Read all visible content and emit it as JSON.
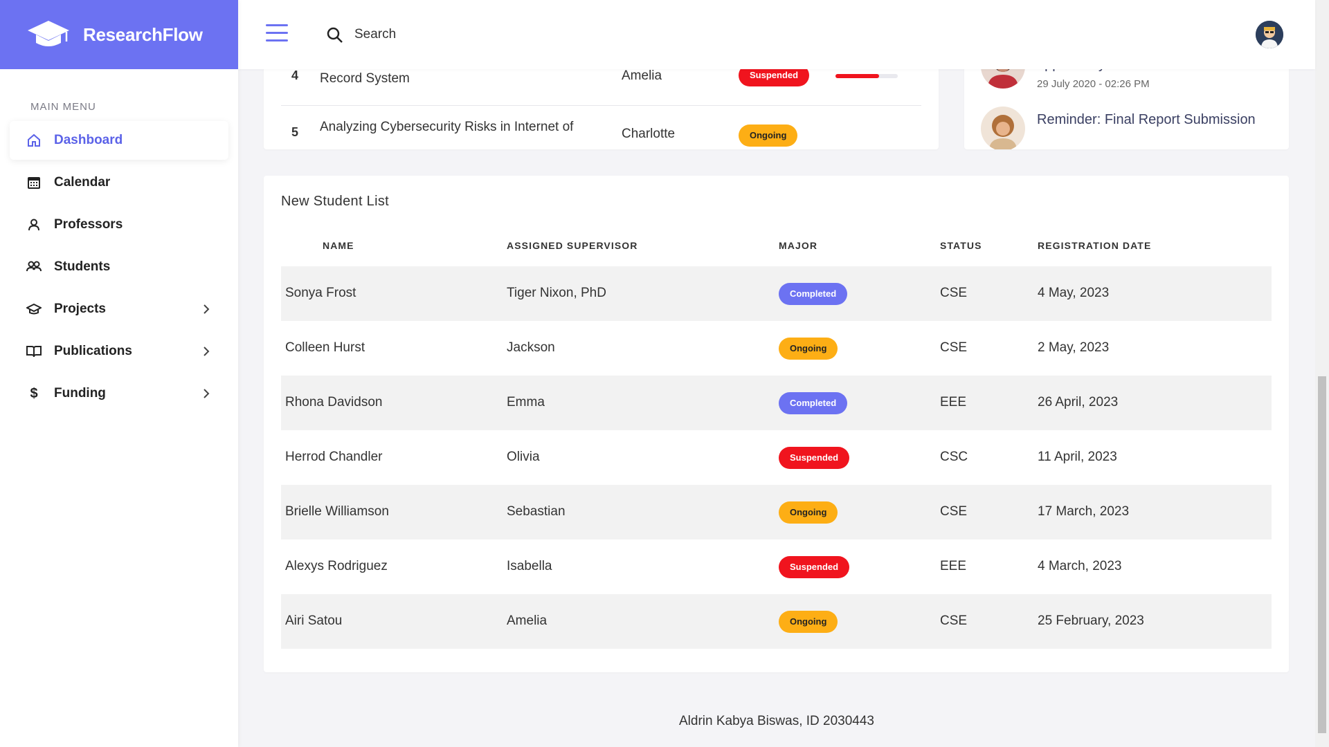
{
  "brand": {
    "name": "ResearchFlow"
  },
  "sidebar": {
    "heading": "MAIN MENU",
    "items": [
      {
        "label": "Dashboard",
        "icon": "home-icon",
        "active": true
      },
      {
        "label": "Calendar",
        "icon": "calendar-icon"
      },
      {
        "label": "Professors",
        "icon": "user-icon"
      },
      {
        "label": "Students",
        "icon": "users-icon"
      },
      {
        "label": "Projects",
        "icon": "graduation-cap-icon",
        "chevron": true
      },
      {
        "label": "Publications",
        "icon": "book-open-icon",
        "chevron": true
      },
      {
        "label": "Funding",
        "icon": "dollar-icon",
        "chevron": true
      }
    ]
  },
  "topbar": {
    "search_placeholder": "Search"
  },
  "projects": {
    "rows": [
      {
        "num": "4",
        "title": "Developing a Cloud-Based Electronic Health Record System",
        "supervisor": "Amelia",
        "status": "Suspended",
        "progress": 0.7
      },
      {
        "num": "5",
        "title": "Analyzing Cybersecurity Risks in Internet of",
        "supervisor": "Charlotte",
        "status": "Ongoing"
      }
    ]
  },
  "notifications": [
    {
      "title": "opportunity",
      "time": "29 July 2020 - 02:26 PM"
    },
    {
      "title": "Reminder: Final Report Submission"
    }
  ],
  "students": {
    "title": "New Student List",
    "headers": [
      "NAME",
      "ASSIGNED SUPERVISOR",
      "MAJOR",
      "STATUS",
      "REGISTRATION DATE"
    ],
    "rows": [
      {
        "name": "Sonya Frost",
        "supervisor": "Tiger Nixon, PhD",
        "badge": "Completed",
        "dept": "CSE",
        "date": "4 May, 2023"
      },
      {
        "name": "Colleen Hurst",
        "supervisor": "Jackson",
        "badge": "Ongoing",
        "dept": "CSE",
        "date": "2 May, 2023"
      },
      {
        "name": "Rhona Davidson",
        "supervisor": "Emma",
        "badge": "Completed",
        "dept": "EEE",
        "date": "26 April, 2023"
      },
      {
        "name": "Herrod Chandler",
        "supervisor": "Olivia",
        "badge": "Suspended",
        "dept": "CSC",
        "date": "11 April, 2023"
      },
      {
        "name": "Brielle Williamson",
        "supervisor": "Sebastian",
        "badge": "Ongoing",
        "dept": "CSE",
        "date": "17 March, 2023"
      },
      {
        "name": "Alexys Rodriguez",
        "supervisor": "Isabella",
        "badge": "Suspended",
        "dept": "EEE",
        "date": "4 March, 2023"
      },
      {
        "name": "Airi Satou",
        "supervisor": "Amelia",
        "badge": "Ongoing",
        "dept": "CSE",
        "date": "25 February, 2023"
      }
    ]
  },
  "footer": {
    "text": "Aldrin Kabya Biswas, ID 2030443"
  },
  "colors": {
    "accent": "#6c72f2",
    "suspended": "#f0141e",
    "ongoing": "#fdae15",
    "completed": "#6c72f2"
  }
}
